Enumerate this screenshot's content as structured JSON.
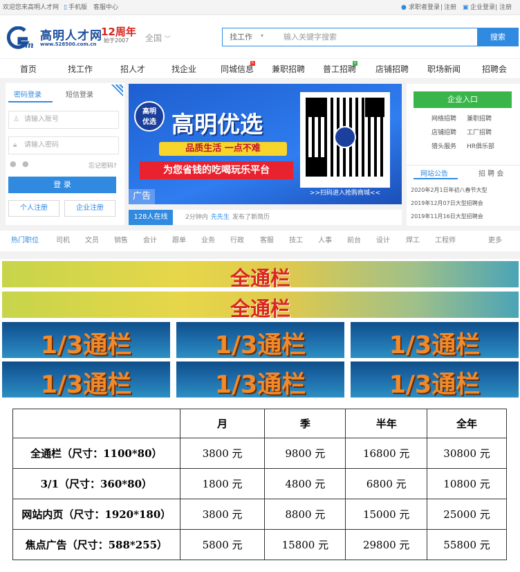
{
  "topbar": {
    "welcome": "欢迎您来高明人才网",
    "mobile": "手机版",
    "service": "客服中心",
    "seeker_login": "求职者登录",
    "register1": "注册",
    "company_login": "企业登录",
    "register2": "注册"
  },
  "header": {
    "logo_text": "高明人才网",
    "logo_url": "www.528500.com.cn",
    "anniversary": "12周年",
    "since": "始于2007",
    "region": "全国",
    "search_category": "找工作",
    "search_placeholder": "输入关键字搜索",
    "search_button": "搜索"
  },
  "nav": {
    "items": [
      "首页",
      "找工作",
      "招人才",
      "找企业",
      "同城信息",
      "兼职招聘",
      "普工招聘",
      "店铺招聘",
      "职场新闻",
      "招聘会"
    ]
  },
  "login": {
    "tab_password": "密码登录",
    "tab_sms": "短信登录",
    "account_placeholder": "请输入账号",
    "password_placeholder": "请输入密码",
    "forgot": "忘记密码?",
    "login_button": "登 录",
    "personal_register": "个人注册",
    "company_register": "企业注册"
  },
  "banner": {
    "badge": "高明\n优选",
    "title": "高明优选",
    "slogan": "品质生活 一点不难",
    "tagline": "为您省钱的吃喝玩乐平台",
    "ad_label": "广告",
    "qr_caption": ">>扫码进入抢购商城<<"
  },
  "online": {
    "count": "128人在线",
    "prefix": "2分钟内",
    "user": "先先生",
    "action": "发布了新简历"
  },
  "company": {
    "entry": "企业入口",
    "links": [
      "网络招聘",
      "兼职招聘",
      "店铺招聘",
      "工厂招聘",
      "猎头服务",
      "HR俱乐部"
    ],
    "tab_notice": "网站公告",
    "tab_fair": "招 聘 会",
    "news": [
      "2020年2月1日年初八春节大型",
      "2019年12月07日大型招聘会",
      "2019年11月16日大型招聘会"
    ]
  },
  "hotjobs": {
    "label": "热门职位",
    "items": [
      "司机",
      "文员",
      "销售",
      "会计",
      "跟单",
      "业务",
      "行政",
      "客服",
      "技工",
      "人事",
      "前台",
      "设计",
      "焊工",
      "工程师"
    ],
    "more": "更多"
  },
  "ads": {
    "full": "全通栏",
    "third": "1/3通栏"
  },
  "price_table": {
    "headers": [
      "",
      "月",
      "季",
      "半年",
      "全年"
    ],
    "rows": [
      {
        "label": "全通栏（尺寸：1100*80）",
        "values": [
          "3800 元",
          "9800 元",
          "16800 元",
          "30800 元"
        ]
      },
      {
        "label": "3/1（尺寸：360*80）",
        "values": [
          "1800 元",
          "4800 元",
          "6800 元",
          "10800 元"
        ]
      },
      {
        "label": "网站内页（尺寸：1920*180）",
        "values": [
          "3800 元",
          "8800 元",
          "15000 元",
          "25000 元"
        ]
      },
      {
        "label": "焦点广告（尺寸：588*255）",
        "values": [
          "5800 元",
          "15800 元",
          "29800 元",
          "55800 元"
        ]
      }
    ]
  },
  "colors": {
    "primary_blue": "#2f8ae0",
    "green": "#3ab54a",
    "red": "#d9241c"
  }
}
